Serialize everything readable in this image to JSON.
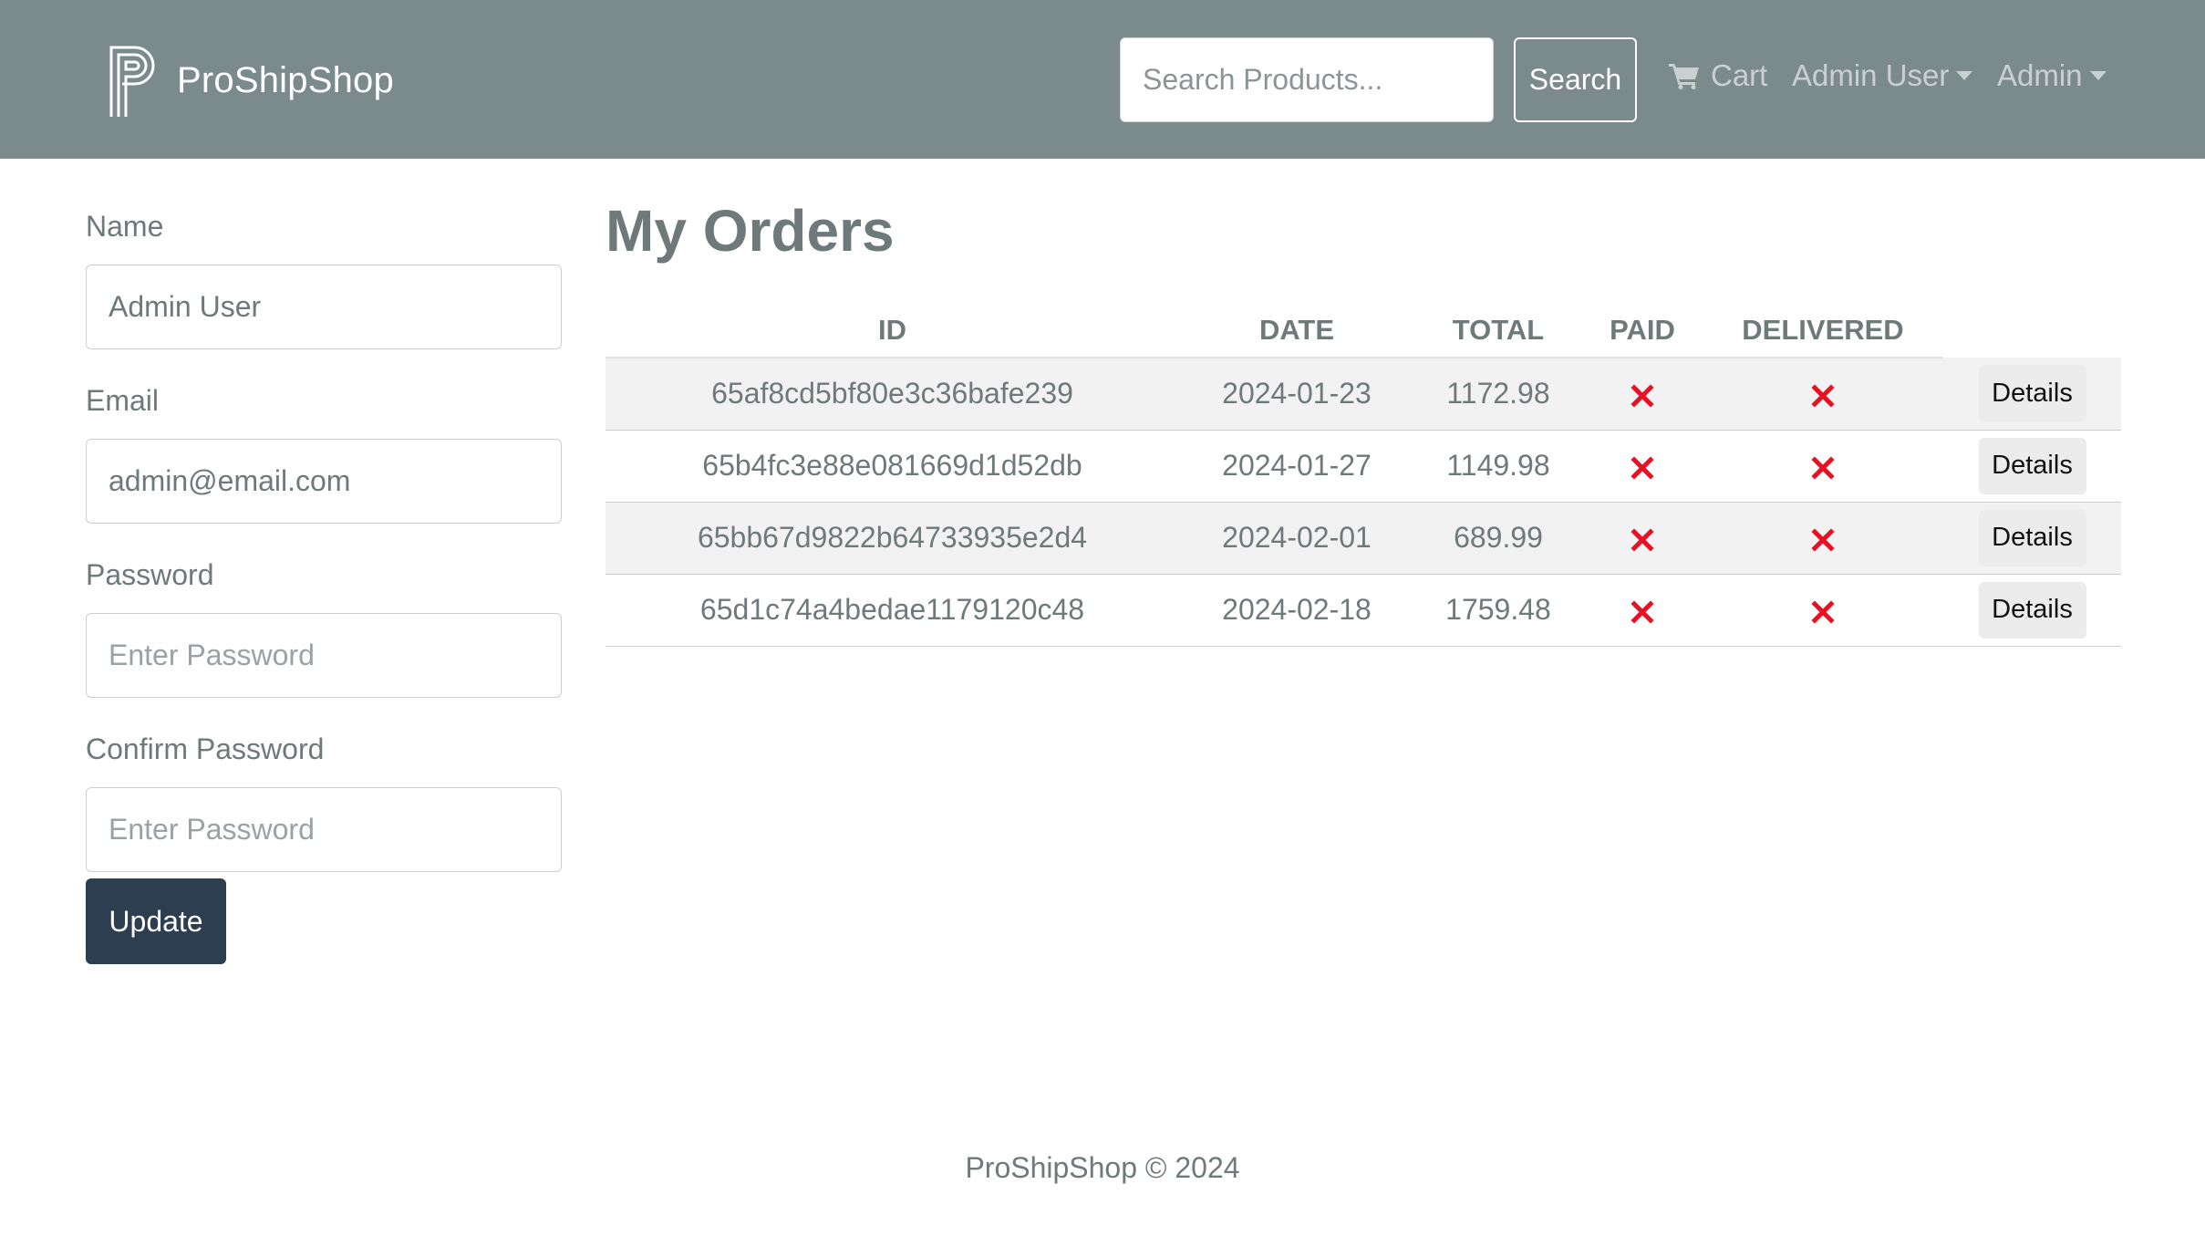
{
  "navbar": {
    "brand_name": "ProShipShop",
    "search_placeholder": "Search Products...",
    "search_label": "Search",
    "cart_label": "Cart",
    "user_label": "Admin User",
    "admin_label": "Admin",
    "background_color": "#7b8a8b"
  },
  "profile": {
    "name_label": "Name",
    "name_value": "Admin User",
    "email_label": "Email",
    "email_value": "admin@email.com",
    "password_label": "Password",
    "password_placeholder": "Enter Password",
    "confirm_label": "Confirm Password",
    "confirm_placeholder": "Enter Password",
    "update_label": "Update"
  },
  "orders": {
    "title": "My Orders",
    "headers": [
      "ID",
      "DATE",
      "TOTAL",
      "PAID",
      "DELIVERED",
      ""
    ],
    "rows": [
      {
        "id": "65af8cd5bf80e3c36bafe239",
        "date": "2024-01-23",
        "total": "1172.98",
        "paid": false,
        "delivered": false,
        "action": "Details"
      },
      {
        "id": "65b4fc3e88e081669d1d52db",
        "date": "2024-01-27",
        "total": "1149.98",
        "paid": false,
        "delivered": false,
        "action": "Details"
      },
      {
        "id": "65bb67d9822b64733935e2d4",
        "date": "2024-02-01",
        "total": "689.99",
        "paid": false,
        "delivered": false,
        "action": "Details"
      },
      {
        "id": "65d1c74a4bedae1179120c48",
        "date": "2024-02-18",
        "total": "1759.48",
        "paid": false,
        "delivered": false,
        "action": "Details"
      }
    ]
  },
  "footer": {
    "text": "ProShipShop © 2024"
  },
  "colors": {
    "accent_dark": "#2c3e50",
    "status_no": "#e81123"
  }
}
